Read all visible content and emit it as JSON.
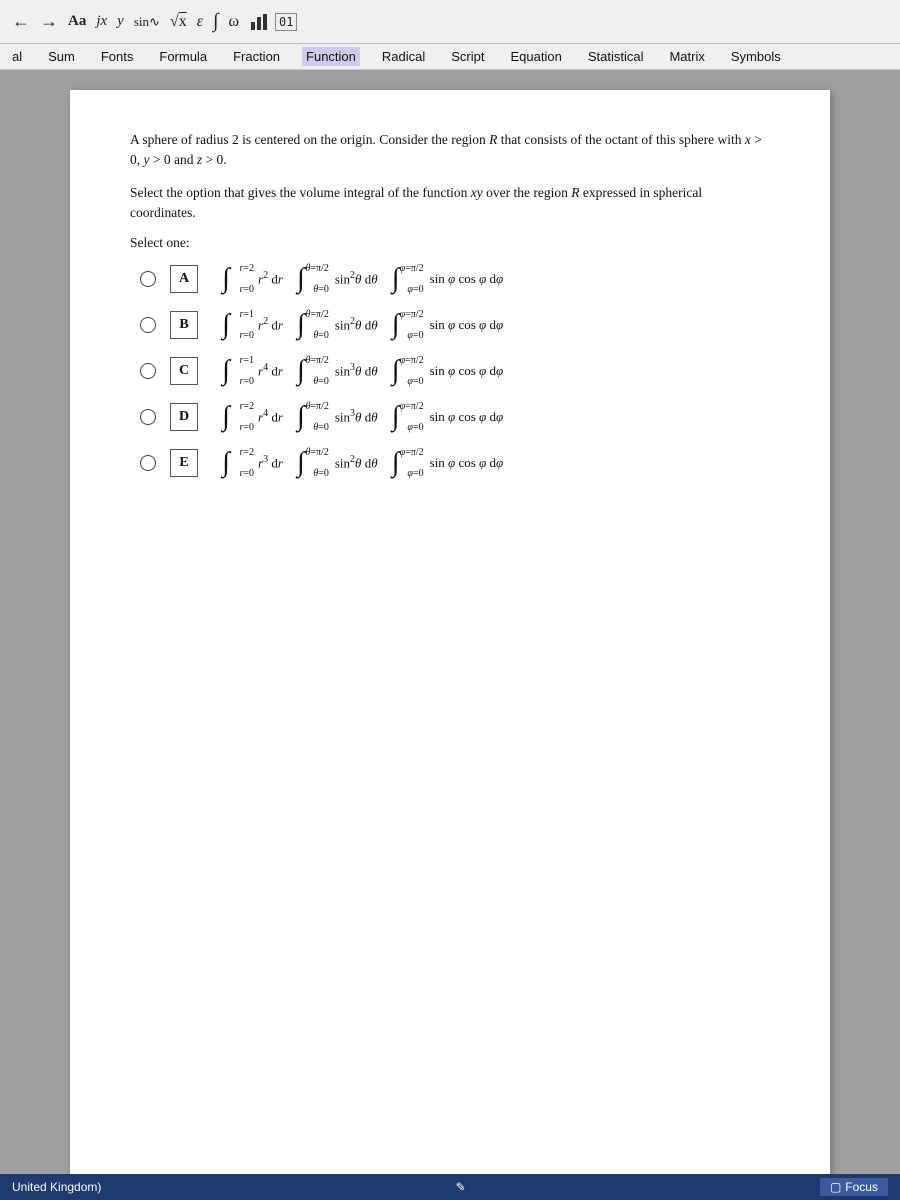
{
  "toolbar": {
    "icons": [
      "undo",
      "redo",
      "font-aa",
      "italic-x",
      "italic-y",
      "sine",
      "sqrt",
      "epsilon",
      "integral",
      "omega",
      "bar-chart",
      "number-box"
    ]
  },
  "menubar": {
    "items": [
      {
        "label": "al",
        "id": "al"
      },
      {
        "label": "Sum",
        "id": "sum"
      },
      {
        "label": "Fonts",
        "id": "fonts"
      },
      {
        "label": "Formula",
        "id": "formula"
      },
      {
        "label": "Fraction",
        "id": "fraction"
      },
      {
        "label": "Function",
        "id": "function",
        "active": true
      },
      {
        "label": "Radical",
        "id": "radical"
      },
      {
        "label": "Script",
        "id": "script"
      },
      {
        "label": "Equation",
        "id": "equation"
      },
      {
        "label": "Statistical",
        "id": "statistical"
      },
      {
        "label": "Matrix",
        "id": "matrix"
      },
      {
        "label": "Symbols",
        "id": "symbols"
      }
    ],
    "eq_label": "01"
  },
  "problem": {
    "text1": "A sphere of radius 2 is centered on the origin. Consider the region R that consists of the octant of this sphere with x > 0, y > 0 and z > 0.",
    "text2": "Select the option that gives the volume integral of the function xy over the region R expressed in spherical coordinates.",
    "select_label": "Select one:",
    "options": [
      {
        "letter": "A",
        "r_lower": "r=0",
        "r_upper": "r=2",
        "r_power": "2",
        "theta_lower": "θ=0",
        "theta_upper": "θ=π/2",
        "sin_theta_power": "2",
        "phi_lower": "φ=0",
        "phi_upper": "φ=π/2",
        "sin_phi": "sin φ cos φ dφ"
      },
      {
        "letter": "B",
        "r_lower": "r=0",
        "r_upper": "r=1",
        "r_power": "2",
        "theta_lower": "θ=0",
        "theta_upper": "θ=π/2",
        "sin_theta_power": "2",
        "phi_lower": "φ=0",
        "phi_upper": "φ=π/2",
        "sin_phi": "sin φ cos φ dφ"
      },
      {
        "letter": "C",
        "r_lower": "r=0",
        "r_upper": "r=1",
        "r_power": "4",
        "theta_lower": "θ=0",
        "theta_upper": "θ=π/2",
        "sin_theta_power": "3",
        "phi_lower": "φ=0",
        "phi_upper": "φ=π/2",
        "sin_phi": "sin φ cos φ dφ"
      },
      {
        "letter": "D",
        "r_lower": "r=0",
        "r_upper": "r=2",
        "r_power": "4",
        "theta_lower": "θ=0",
        "theta_upper": "θ=π/2",
        "sin_theta_power": "3",
        "phi_lower": "φ=0",
        "phi_upper": "φ=π/2",
        "sin_phi": "sin φ cos φ dφ"
      },
      {
        "letter": "E",
        "r_lower": "r=0",
        "r_upper": "r=2",
        "r_power": "3",
        "theta_lower": "θ=0",
        "theta_upper": "θ=π/2",
        "sin_theta_power": "2",
        "phi_lower": "φ=0",
        "phi_upper": "φ=π/2",
        "sin_phi": "sin φ cos φ dφ"
      }
    ]
  },
  "statusbar": {
    "region": "United Kingdom)",
    "cursor_icon": "cursor",
    "focus_label": "Focus"
  }
}
